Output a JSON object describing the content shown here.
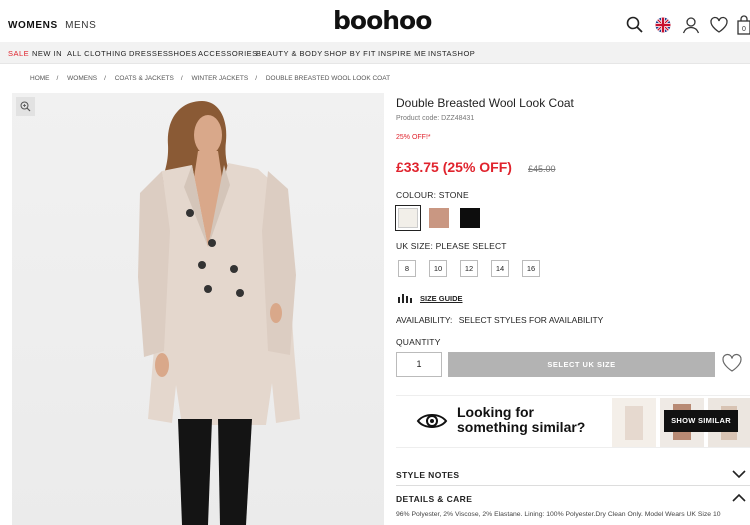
{
  "header": {
    "gender_tabs": [
      "WOMENS",
      "MENS"
    ],
    "logo": "boohoo",
    "icons": [
      "search-icon",
      "uk-flag-icon",
      "account-icon",
      "wishlist-icon",
      "bag-icon"
    ],
    "bag_count": "0"
  },
  "nav": {
    "items": [
      "SALE",
      "NEW IN",
      "ALL CLOTHING",
      "DRESSES",
      "SHOES",
      "ACCESSORIES",
      "BEAUTY & BODY",
      "SHOP BY FIT",
      "INSPIRE ME",
      "INSTASHOP"
    ]
  },
  "breadcrumb": [
    "HOME",
    "WOMENS",
    "COATS & JACKETS",
    "WINTER JACKETS",
    "DOUBLE BREASTED WOOL LOOK COAT"
  ],
  "product": {
    "title": "Double Breasted Wool Look Coat",
    "code": "Product code: DZZ48431",
    "discount_note": "25% OFF!*",
    "price": "£33.75 (25% OFF)",
    "was_price": "£45.00",
    "colour_label": "COLOUR:",
    "colour_value": "STONE",
    "swatches": [
      {
        "name": "stone",
        "color": "#f2efe9"
      },
      {
        "name": "camel",
        "color": "#c99782"
      },
      {
        "name": "black",
        "color": "#0d0d0d"
      }
    ],
    "size_label": "UK SIZE:",
    "size_value": "PLEASE SELECT",
    "sizes": [
      "8",
      "10",
      "12",
      "14",
      "16"
    ],
    "size_guide": "SIZE GUIDE",
    "availability_label": "AVAILABILITY:",
    "availability_value": "SELECT STYLES FOR AVAILABILITY",
    "quantity_label": "QUANTITY",
    "quantity_value": "1",
    "add_button": "SELECT UK SIZE"
  },
  "similar": {
    "line1": "Looking for",
    "line2": "something similar?",
    "button": "SHOW SIMILAR"
  },
  "accordion": {
    "style_notes": "STYLE NOTES",
    "details_care": "DETAILS & CARE",
    "details_text": "96% Polyester, 2% Viscose, 2% Elastane. Lining: 100% Polyester.Dry Clean Only. Model Wears UK Size 10"
  },
  "colors": {
    "sale_red": "#e0232d",
    "button_grey": "#b3b3b3",
    "coat": "#e4d7cd"
  }
}
